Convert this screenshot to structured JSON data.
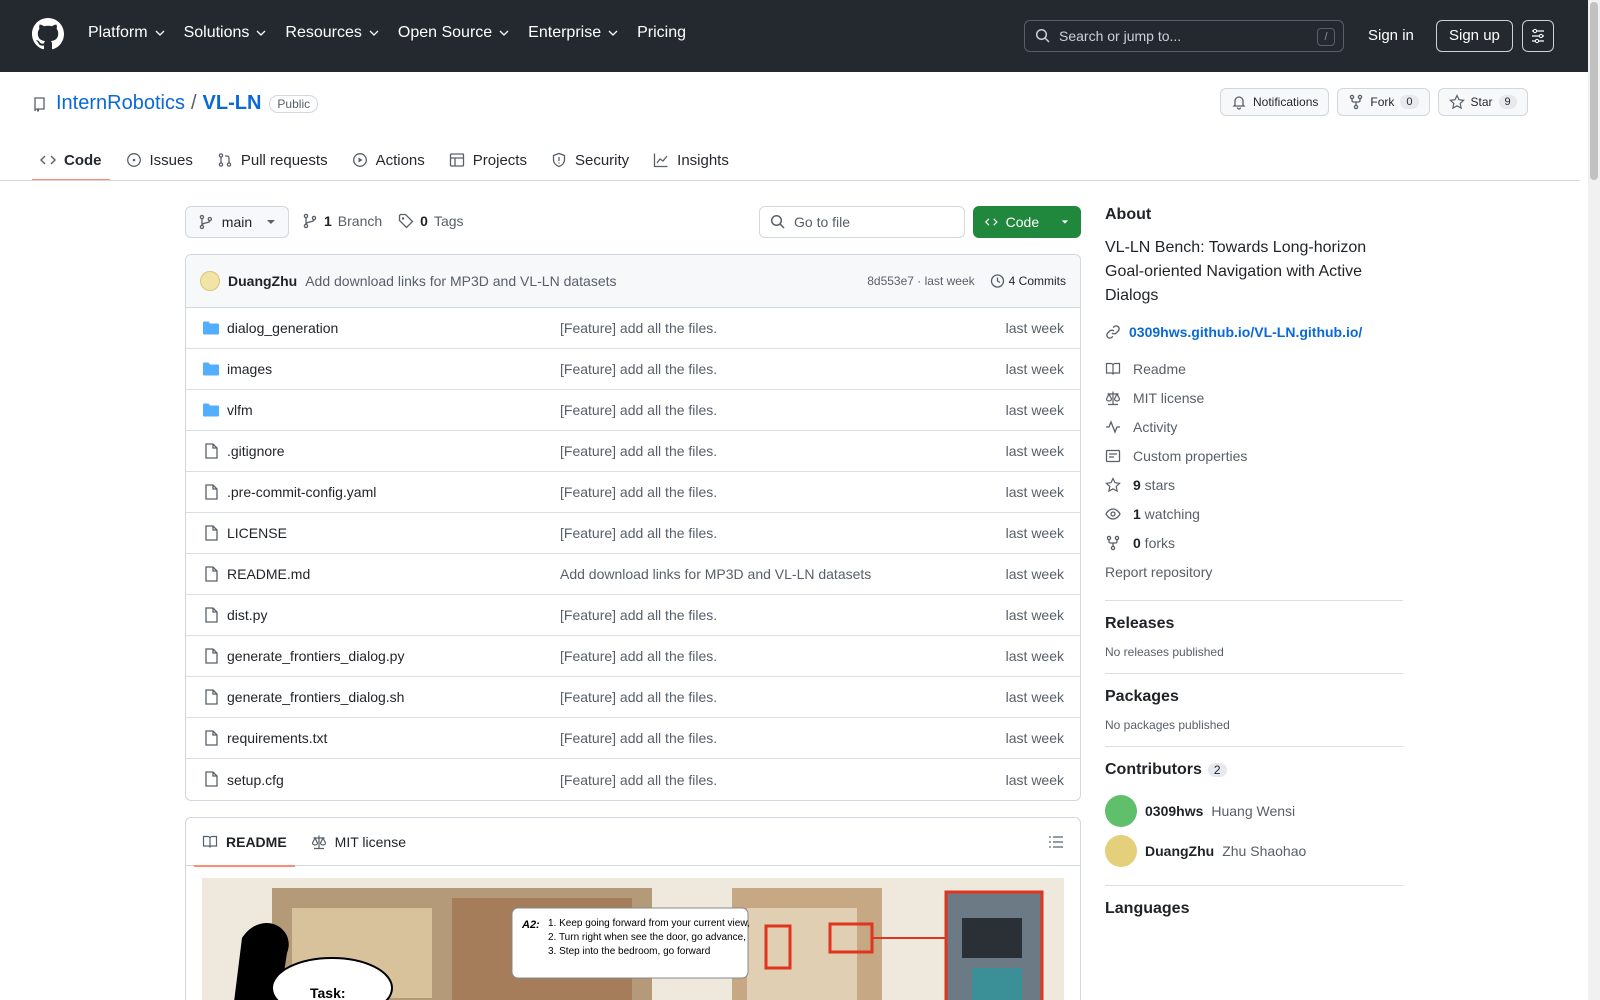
{
  "header": {
    "nav": [
      "Platform",
      "Solutions",
      "Resources",
      "Open Source",
      "Enterprise",
      "Pricing"
    ],
    "search_placeholder": "Search or jump to...",
    "search_key": "/",
    "signin": "Sign in",
    "signup": "Sign up"
  },
  "repo": {
    "owner": "InternRobotics",
    "name": "VL-LN",
    "visibility": "Public",
    "notifications": "Notifications",
    "fork_label": "Fork",
    "fork_count": "0",
    "star_label": "Star",
    "star_count": "9"
  },
  "tabs": [
    "Code",
    "Issues",
    "Pull requests",
    "Actions",
    "Projects",
    "Security",
    "Insights"
  ],
  "branch": {
    "name": "main",
    "branch_count": "1",
    "branch_label": "Branch",
    "tag_count": "0",
    "tag_label": "Tags",
    "goto_placeholder": "Go to file",
    "code_label": "Code"
  },
  "commit": {
    "user": "DuangZhu",
    "message": "Add download links for MP3D and VL-LN datasets",
    "hash": "8d553e7",
    "time": "last week",
    "commits_label": "4 Commits"
  },
  "files": [
    {
      "name": "dialog_generation",
      "type": "dir",
      "msg": "[Feature] add all the files.",
      "time": "last week"
    },
    {
      "name": "images",
      "type": "dir",
      "msg": "[Feature] add all the files.",
      "time": "last week"
    },
    {
      "name": "vlfm",
      "type": "dir",
      "msg": "[Feature] add all the files.",
      "time": "last week"
    },
    {
      "name": ".gitignore",
      "type": "file",
      "msg": "[Feature] add all the files.",
      "time": "last week"
    },
    {
      "name": ".pre-commit-config.yaml",
      "type": "file",
      "msg": "[Feature] add all the files.",
      "time": "last week"
    },
    {
      "name": "LICENSE",
      "type": "file",
      "msg": "[Feature] add all the files.",
      "time": "last week"
    },
    {
      "name": "README.md",
      "type": "file",
      "msg": "Add download links for MP3D and VL-LN datasets",
      "time": "last week"
    },
    {
      "name": "dist.py",
      "type": "file",
      "msg": "[Feature] add all the files.",
      "time": "last week"
    },
    {
      "name": "generate_frontiers_dialog.py",
      "type": "file",
      "msg": "[Feature] add all the files.",
      "time": "last week"
    },
    {
      "name": "generate_frontiers_dialog.sh",
      "type": "file",
      "msg": "[Feature] add all the files.",
      "time": "last week"
    },
    {
      "name": "requirements.txt",
      "type": "file",
      "msg": "[Feature] add all the files.",
      "time": "last week"
    },
    {
      "name": "setup.cfg",
      "type": "file",
      "msg": "[Feature] add all the files.",
      "time": "last week"
    }
  ],
  "readme_tabs": [
    "README",
    "MIT license"
  ],
  "readme_figure": {
    "a2_label": "A2:",
    "a2_lines": [
      "1. Keep going forward from your current view,",
      "2. Turn right when see the door, go advance,",
      "3. Step into the bedroom, go forward"
    ],
    "task_label": "Task:"
  },
  "about": {
    "title": "About",
    "description": "VL-LN Bench: Towards Long-horizon Goal-oriented Navigation with Active Dialogs",
    "link": "0309hws.github.io/VL-LN.github.io/",
    "items": [
      {
        "icon": "book-icon",
        "label": "Readme",
        "bold": ""
      },
      {
        "icon": "scale-icon",
        "label": "MIT license",
        "bold": ""
      },
      {
        "icon": "pulse-icon",
        "label": "Activity",
        "bold": ""
      },
      {
        "icon": "note-icon",
        "label": "Custom properties",
        "bold": ""
      },
      {
        "icon": "star-icon",
        "label": " stars",
        "bold": "9"
      },
      {
        "icon": "eye-icon",
        "label": " watching",
        "bold": "1"
      },
      {
        "icon": "fork-icon",
        "label": " forks",
        "bold": "0"
      }
    ],
    "report": "Report repository"
  },
  "releases": {
    "title": "Releases",
    "text": "No releases published"
  },
  "packages": {
    "title": "Packages",
    "text": "No packages published"
  },
  "contributors": {
    "title": "Contributors",
    "count": "2",
    "list": [
      {
        "login": "0309hws",
        "name": "Huang Wensi",
        "color": "#5fbf6a"
      },
      {
        "login": "DuangZhu",
        "name": "Zhu Shaohao",
        "color": "#e4cf7a"
      }
    ]
  },
  "languages": {
    "title": "Languages"
  }
}
